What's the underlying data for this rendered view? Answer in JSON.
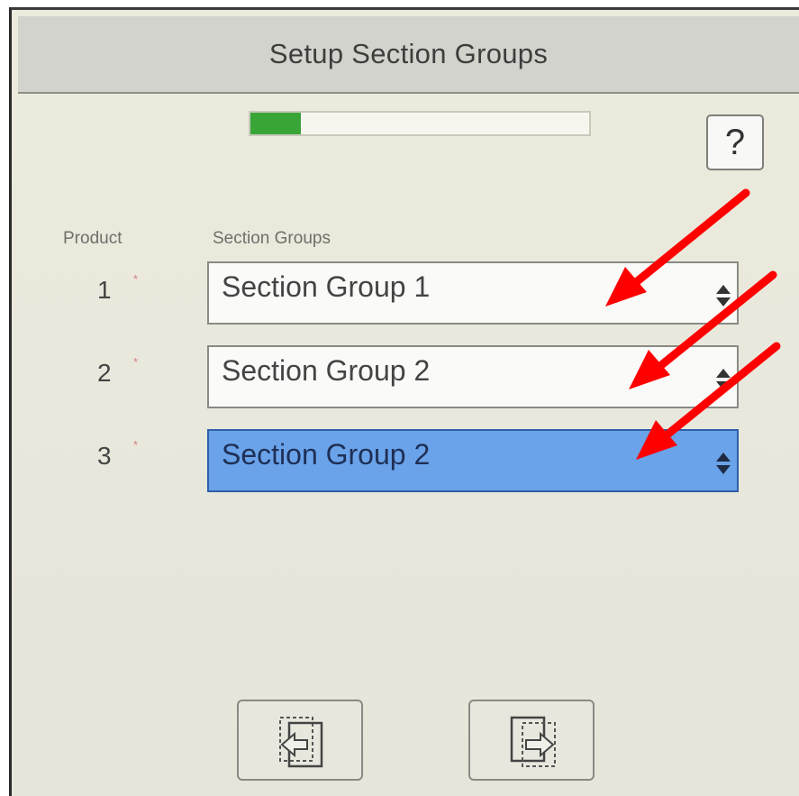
{
  "header": {
    "title": "Setup Section Groups"
  },
  "progress": {
    "value": 0.15,
    "color": "#39a536"
  },
  "help": {
    "label": "?"
  },
  "columns": {
    "product": "Product",
    "section_groups": "Section Groups"
  },
  "rows": [
    {
      "number": "1",
      "required_mark": "*",
      "value": "Section Group 1",
      "selected": false
    },
    {
      "number": "2",
      "required_mark": "*",
      "value": "Section Group 2",
      "selected": false
    },
    {
      "number": "3",
      "required_mark": "*",
      "value": "Section Group 2",
      "selected": true
    }
  ],
  "colors": {
    "accent": "#6aa3ea",
    "annotation_arrow": "#ff0000"
  },
  "icons": {
    "back": "page-back-icon",
    "next": "page-next-icon",
    "spinner": "up-down-chevron-icon"
  }
}
